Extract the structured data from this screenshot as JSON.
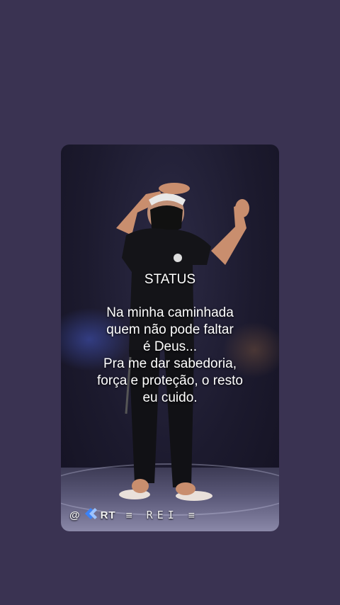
{
  "post": {
    "heading": "STATUS",
    "quote_lines": [
      "Na minha caminhada",
      "quem não pode faltar",
      "é Deus...",
      "Pra me dar sabedoria,",
      "força e proteção, o resto",
      "eu cuido."
    ]
  },
  "watermark": {
    "handle_prefix": "@",
    "handle_tag": "RT",
    "separator": "≡",
    "name": "REI"
  },
  "icons": [
    "k-logo-icon"
  ],
  "colors": {
    "background": "#3a3352",
    "text": "#ffffff",
    "logo_blue": "#3b82f6"
  }
}
